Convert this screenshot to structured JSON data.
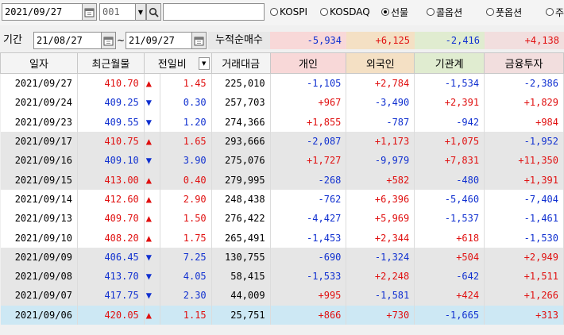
{
  "toolbar": {
    "date": "2021/09/27",
    "code": "001",
    "name": "",
    "markets": [
      {
        "label": "KOSPI",
        "selected": false
      },
      {
        "label": "KOSDAQ",
        "selected": false
      },
      {
        "label": "선물",
        "selected": true
      },
      {
        "label": "콜옵션",
        "selected": false
      },
      {
        "label": "풋옵션",
        "selected": false
      },
      {
        "label": "주",
        "selected": false
      }
    ]
  },
  "period": {
    "label": "기간",
    "from": "21/08/27",
    "tilde": "~",
    "to": "21/09/27",
    "cumulative_label": "누적순매수",
    "totals": [
      "-5,934",
      "+6,125",
      "-2,416",
      "+4,138"
    ]
  },
  "columns": [
    "일자",
    "최근월물",
    "전일비",
    "거래대금",
    "개인",
    "외국인",
    "기관계",
    "금융투자"
  ],
  "colors": {
    "up": "#e01010",
    "down": "#1030d0"
  },
  "rows": [
    {
      "date": "2021/09/27",
      "price": "410.70",
      "dir": "up",
      "change": "1.45",
      "amount": "225,010",
      "individual": "-1,105",
      "foreign": "+2,784",
      "institution": "-1,534",
      "financial": "-2,386"
    },
    {
      "date": "2021/09/24",
      "price": "409.25",
      "dir": "down",
      "change": "0.30",
      "amount": "257,703",
      "individual": "+967",
      "foreign": "-3,490",
      "institution": "+2,391",
      "financial": "+1,829"
    },
    {
      "date": "2021/09/23",
      "price": "409.55",
      "dir": "down",
      "change": "1.20",
      "amount": "274,366",
      "individual": "+1,855",
      "foreign": "-787",
      "institution": "-942",
      "financial": "+984"
    },
    {
      "date": "2021/09/17",
      "price": "410.75",
      "dir": "up",
      "change": "1.65",
      "amount": "293,666",
      "individual": "-2,087",
      "foreign": "+1,173",
      "institution": "+1,075",
      "financial": "-1,952"
    },
    {
      "date": "2021/09/16",
      "price": "409.10",
      "dir": "down",
      "change": "3.90",
      "amount": "275,076",
      "individual": "+1,727",
      "foreign": "-9,979",
      "institution": "+7,831",
      "financial": "+11,350"
    },
    {
      "date": "2021/09/15",
      "price": "413.00",
      "dir": "up",
      "change": "0.40",
      "amount": "279,995",
      "individual": "-268",
      "foreign": "+582",
      "institution": "-480",
      "financial": "+1,391"
    },
    {
      "date": "2021/09/14",
      "price": "412.60",
      "dir": "up",
      "change": "2.90",
      "amount": "248,438",
      "individual": "-762",
      "foreign": "+6,396",
      "institution": "-5,460",
      "financial": "-7,404"
    },
    {
      "date": "2021/09/13",
      "price": "409.70",
      "dir": "up",
      "change": "1.50",
      "amount": "276,422",
      "individual": "-4,427",
      "foreign": "+5,969",
      "institution": "-1,537",
      "financial": "-1,461"
    },
    {
      "date": "2021/09/10",
      "price": "408.20",
      "dir": "up",
      "change": "1.75",
      "amount": "265,491",
      "individual": "-1,453",
      "foreign": "+2,344",
      "institution": "+618",
      "financial": "-1,530"
    },
    {
      "date": "2021/09/09",
      "price": "406.45",
      "dir": "down",
      "change": "7.25",
      "amount": "130,755",
      "individual": "-690",
      "foreign": "-1,324",
      "institution": "+504",
      "financial": "+2,949"
    },
    {
      "date": "2021/09/08",
      "price": "413.70",
      "dir": "down",
      "change": "4.05",
      "amount": "58,415",
      "individual": "-1,533",
      "foreign": "+2,248",
      "institution": "-642",
      "financial": "+1,511"
    },
    {
      "date": "2021/09/07",
      "price": "417.75",
      "dir": "down",
      "change": "2.30",
      "amount": "44,009",
      "individual": "+995",
      "foreign": "-1,581",
      "institution": "+424",
      "financial": "+1,266"
    },
    {
      "date": "2021/09/06",
      "price": "420.05",
      "dir": "up",
      "change": "1.15",
      "amount": "25,751",
      "individual": "+866",
      "foreign": "+730",
      "institution": "-1,665",
      "financial": "+313"
    }
  ]
}
